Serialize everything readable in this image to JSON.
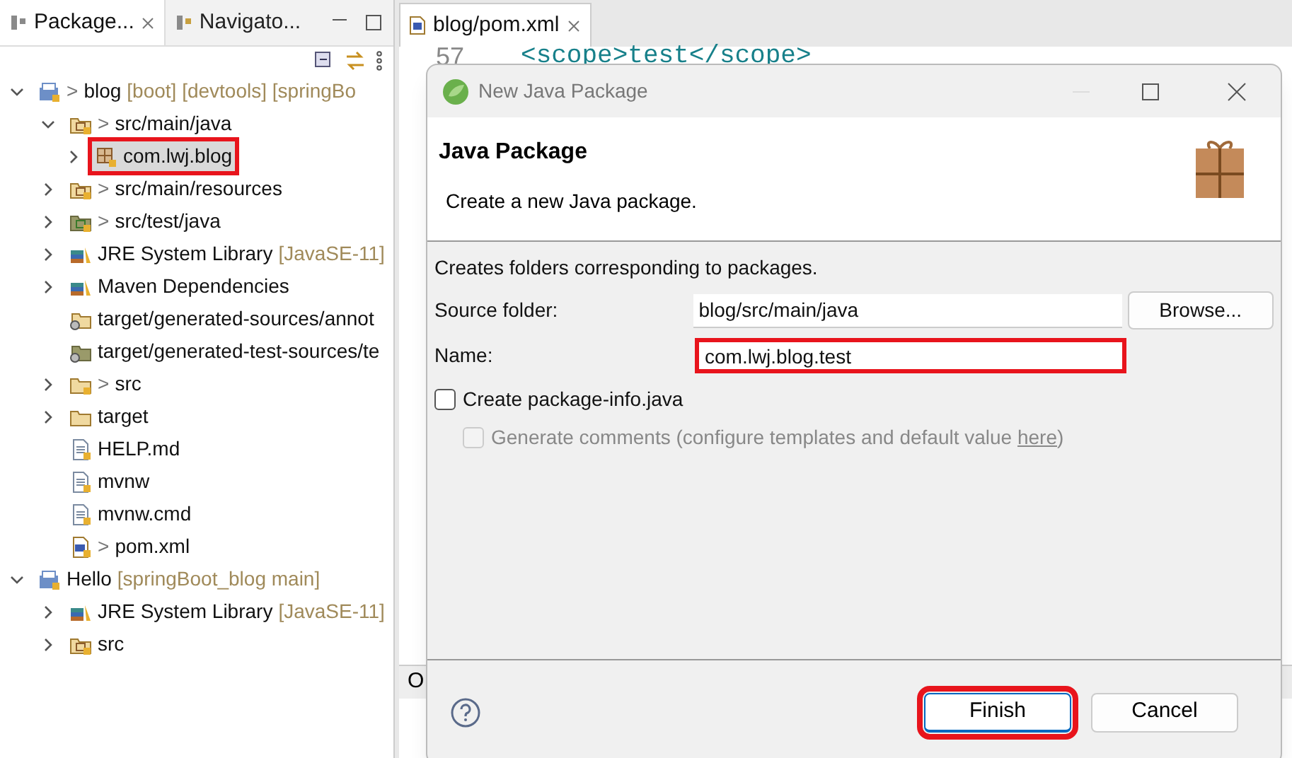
{
  "views": {
    "tabs": [
      {
        "label": "Package...",
        "selected": true
      },
      {
        "label": "Navigato...",
        "selected": false
      }
    ]
  },
  "tree": [
    {
      "kind": "project",
      "prefix": ">",
      "label": "blog",
      "decoration": "[boot] [devtools] [springBo",
      "expanded": true,
      "children": [
        {
          "kind": "source",
          "prefix": ">",
          "label": "src/main/java",
          "expanded": true,
          "children": [
            {
              "kind": "package",
              "label": "com.lwj.blog",
              "expanded": false,
              "selected": true,
              "annotated": true
            }
          ]
        },
        {
          "kind": "source",
          "prefix": ">",
          "label": "src/main/resources",
          "expanded": false
        },
        {
          "kind": "testsource",
          "prefix": ">",
          "label": "src/test/java",
          "expanded": false
        },
        {
          "kind": "library",
          "label": "JRE System Library",
          "decoration": "[JavaSE-11]",
          "expanded": false
        },
        {
          "kind": "library",
          "label": "Maven Dependencies",
          "expanded": false
        },
        {
          "kind": "generated",
          "label": "target/generated-sources/annot"
        },
        {
          "kind": "generatedtest",
          "label": "target/generated-test-sources/te"
        },
        {
          "kind": "folder",
          "prefix": ">",
          "label": "src",
          "expanded": false
        },
        {
          "kind": "plainfolder",
          "label": "target",
          "expanded": false
        },
        {
          "kind": "file",
          "label": "HELP.md"
        },
        {
          "kind": "file",
          "label": "mvnw"
        },
        {
          "kind": "file",
          "label": "mvnw.cmd"
        },
        {
          "kind": "maven",
          "prefix": ">",
          "label": "pom.xml"
        }
      ]
    },
    {
      "kind": "project",
      "label": "Hello",
      "decoration": "[springBoot_blog main]",
      "expanded": true,
      "children": [
        {
          "kind": "library",
          "label": "JRE System Library",
          "decoration": "[JavaSE-11]",
          "expanded": false
        },
        {
          "kind": "source",
          "label": "src",
          "expanded": false
        }
      ]
    }
  ],
  "editor": {
    "tab": "blog/pom.xml",
    "line_number": "57",
    "code": "<scope>test</scope>",
    "hidden_tab_fragment": "O"
  },
  "dialog": {
    "title": "New Java Package",
    "heading": "Java Package",
    "description": "Create a new Java package.",
    "message": "Creates folders corresponding to packages.",
    "source_folder": {
      "label": "Source folder:",
      "value": "blog/src/main/java"
    },
    "browse": "Browse...",
    "name": {
      "label": "Name:",
      "value": "com.lwj.blog.test",
      "annotated": true
    },
    "create_info": {
      "label": "Create package-info.java",
      "checked": false
    },
    "generate_comments": {
      "label": "Generate comments (configure templates and default value ",
      "link": "here",
      "after": ")",
      "checked": false,
      "disabled": true
    },
    "buttons": [
      {
        "label": "Finish",
        "kind": "primary",
        "annotated": true
      },
      {
        "label": "Cancel",
        "kind": "normal",
        "annotated": false
      }
    ]
  }
}
